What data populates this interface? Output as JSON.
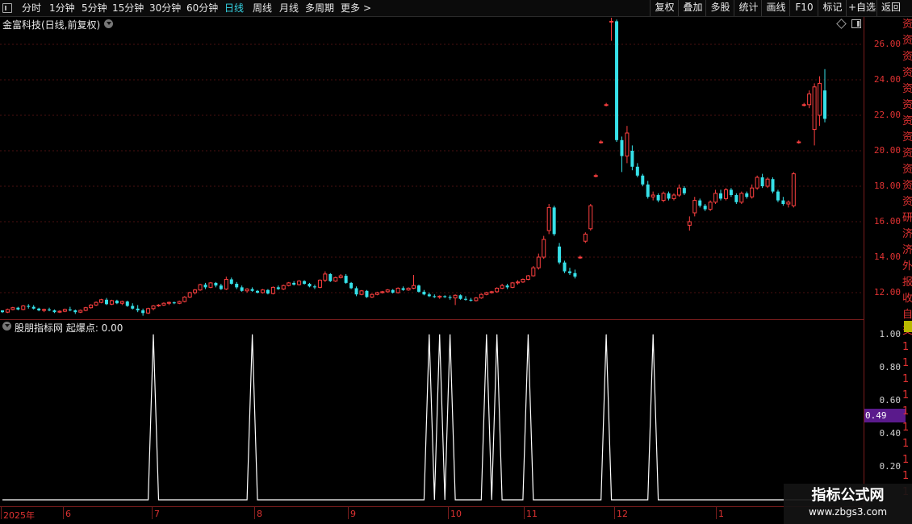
{
  "toolbar": {
    "periods": [
      {
        "label": "分时"
      },
      {
        "label": "1分钟"
      },
      {
        "label": "5分钟"
      },
      {
        "label": "15分钟"
      },
      {
        "label": "30分钟"
      },
      {
        "label": "60分钟"
      },
      {
        "label": "日线",
        "active": true
      },
      {
        "label": "周线"
      },
      {
        "label": "月线"
      },
      {
        "label": "多周期"
      },
      {
        "label": "更多"
      }
    ],
    "more_arrow": ">",
    "right_buttons": [
      {
        "label": "复权"
      },
      {
        "label": "叠加"
      },
      {
        "label": "多股"
      },
      {
        "label": "统计"
      },
      {
        "label": "画线"
      },
      {
        "label": "F10"
      },
      {
        "label": "标记"
      },
      {
        "label": "+自选"
      },
      {
        "label": "返回"
      }
    ]
  },
  "main_chart": {
    "title": "金富科技(日线,前复权)",
    "y_ticks": [
      "26.00",
      "24.00",
      "22.00",
      "20.00",
      "18.00",
      "16.00",
      "14.00",
      "12.00"
    ]
  },
  "indicator": {
    "title": "股朋指标网  起爆点: 0.00",
    "y_ticks": [
      "1.00",
      "0.80",
      "0.60",
      "0.40",
      "0.20"
    ],
    "current_value": "0.49"
  },
  "x_axis": {
    "labels": [
      "2025年",
      "6",
      "7",
      "8",
      "9",
      "10",
      "11",
      "12",
      "1"
    ]
  },
  "side_strip": {
    "chars": [
      "资",
      "资",
      "资",
      "资",
      "资",
      "资",
      "资",
      "资",
      "资",
      "资",
      "资",
      "资",
      "研",
      "济",
      "济",
      "外",
      "报",
      "收",
      "自",
      "交",
      "1",
      "1",
      "1",
      "1",
      "1",
      "1",
      "1",
      "1",
      "1",
      "1"
    ]
  },
  "watermark": {
    "title": "指标公式网",
    "url": "www.zbgs3.com"
  },
  "colors": {
    "up": "#ff4040",
    "down": "#36e0e8",
    "axis": "#e03232",
    "grid": "#4a1010",
    "signal": "#ffffff",
    "badge": "#5a1a8c"
  },
  "chart_data": [
    {
      "type": "candlestick",
      "title": "金富科技(日线,前复权)",
      "x_labels": [
        "2025年",
        "6",
        "7",
        "8",
        "9",
        "10",
        "11",
        "12",
        "1"
      ],
      "ylim": [
        10.5,
        27.5
      ],
      "y_ticks": [
        12,
        14,
        16,
        18,
        20,
        22,
        24,
        26
      ],
      "ohlc": [
        [
          11.0,
          11.0,
          10.85,
          10.9
        ],
        [
          10.9,
          11.1,
          10.85,
          11.05
        ],
        [
          11.05,
          11.2,
          11.0,
          11.15
        ],
        [
          11.15,
          11.2,
          11.0,
          11.05
        ],
        [
          11.05,
          11.3,
          11.0,
          11.25
        ],
        [
          11.25,
          11.35,
          11.1,
          11.2
        ],
        [
          11.2,
          11.3,
          11.05,
          11.1
        ],
        [
          11.1,
          11.15,
          10.95,
          11.0
        ],
        [
          11.0,
          11.1,
          10.9,
          11.05
        ],
        [
          11.05,
          11.15,
          10.95,
          11.0
        ],
        [
          11.0,
          11.05,
          10.85,
          10.9
        ],
        [
          10.9,
          11.0,
          10.85,
          10.95
        ],
        [
          10.95,
          11.1,
          10.9,
          11.05
        ],
        [
          11.05,
          11.2,
          10.95,
          11.0
        ],
        [
          11.0,
          11.05,
          10.8,
          10.9
        ],
        [
          10.9,
          11.05,
          10.85,
          11.0
        ],
        [
          11.0,
          11.2,
          10.95,
          11.15
        ],
        [
          11.15,
          11.35,
          11.1,
          11.3
        ],
        [
          11.3,
          11.5,
          11.25,
          11.45
        ],
        [
          11.45,
          11.65,
          11.4,
          11.6
        ],
        [
          11.6,
          11.7,
          11.3,
          11.35
        ],
        [
          11.35,
          11.6,
          11.3,
          11.55
        ],
        [
          11.55,
          11.6,
          11.35,
          11.4
        ],
        [
          11.4,
          11.55,
          11.3,
          11.5
        ],
        [
          11.5,
          11.55,
          11.2,
          11.25
        ],
        [
          11.25,
          11.4,
          11.05,
          11.1
        ],
        [
          11.1,
          11.3,
          10.9,
          11.0
        ],
        [
          11.0,
          11.1,
          10.7,
          10.85
        ],
        [
          10.85,
          11.15,
          10.8,
          11.1
        ],
        [
          11.1,
          11.3,
          11.0,
          11.25
        ],
        [
          11.25,
          11.35,
          11.2,
          11.3
        ],
        [
          11.3,
          11.45,
          11.25,
          11.4
        ],
        [
          11.4,
          11.5,
          11.3,
          11.45
        ],
        [
          11.45,
          11.5,
          11.35,
          11.4
        ],
        [
          11.4,
          11.55,
          11.35,
          11.5
        ],
        [
          11.5,
          11.8,
          11.45,
          11.75
        ],
        [
          11.75,
          12.05,
          11.7,
          12.0
        ],
        [
          12.0,
          12.2,
          11.9,
          12.15
        ],
        [
          12.15,
          12.5,
          12.1,
          12.45
        ],
        [
          12.45,
          12.55,
          12.2,
          12.3
        ],
        [
          12.3,
          12.6,
          12.25,
          12.55
        ],
        [
          12.55,
          12.6,
          12.3,
          12.4
        ],
        [
          12.4,
          12.5,
          12.15,
          12.2
        ],
        [
          12.2,
          12.9,
          12.15,
          12.75
        ],
        [
          12.75,
          12.85,
          12.45,
          12.5
        ],
        [
          12.5,
          12.6,
          12.2,
          12.3
        ],
        [
          12.3,
          12.4,
          12.05,
          12.1
        ],
        [
          12.1,
          12.25,
          12.0,
          12.2
        ],
        [
          12.2,
          12.3,
          12.05,
          12.1
        ],
        [
          12.1,
          12.15,
          11.95,
          12.0
        ],
        [
          12.0,
          12.2,
          11.95,
          12.15
        ],
        [
          12.15,
          12.2,
          11.9,
          11.95
        ],
        [
          11.95,
          12.35,
          11.9,
          12.3
        ],
        [
          12.3,
          12.4,
          12.15,
          12.2
        ],
        [
          12.2,
          12.45,
          12.15,
          12.4
        ],
        [
          12.4,
          12.6,
          12.35,
          12.55
        ],
        [
          12.55,
          12.65,
          12.4,
          12.45
        ],
        [
          12.45,
          12.7,
          12.4,
          12.65
        ],
        [
          12.65,
          12.7,
          12.45,
          12.5
        ],
        [
          12.5,
          12.55,
          12.3,
          12.35
        ],
        [
          12.35,
          12.45,
          12.2,
          12.3
        ],
        [
          12.3,
          12.75,
          12.25,
          12.7
        ],
        [
          12.7,
          13.2,
          12.6,
          13.05
        ],
        [
          13.05,
          13.1,
          12.6,
          12.65
        ],
        [
          12.65,
          12.9,
          12.6,
          12.85
        ],
        [
          12.85,
          13.05,
          12.8,
          12.95
        ],
        [
          12.95,
          13.05,
          12.5,
          12.55
        ],
        [
          12.55,
          12.6,
          12.2,
          12.25
        ],
        [
          12.25,
          12.35,
          11.8,
          11.9
        ],
        [
          11.9,
          12.15,
          11.85,
          12.1
        ],
        [
          12.1,
          12.15,
          11.7,
          11.75
        ],
        [
          11.75,
          11.95,
          11.7,
          11.9
        ],
        [
          11.9,
          12.05,
          11.85,
          12.0
        ],
        [
          12.0,
          12.1,
          11.95,
          12.05
        ],
        [
          12.05,
          12.2,
          12.0,
          12.15
        ],
        [
          12.15,
          12.2,
          11.95,
          12.0
        ],
        [
          12.0,
          12.3,
          11.95,
          12.25
        ],
        [
          12.25,
          12.35,
          12.1,
          12.15
        ],
        [
          12.15,
          12.3,
          12.1,
          12.25
        ],
        [
          12.25,
          13.0,
          12.2,
          12.4
        ],
        [
          12.4,
          12.45,
          12.0,
          12.05
        ],
        [
          12.05,
          12.15,
          11.85,
          11.9
        ],
        [
          11.9,
          12.0,
          11.75,
          11.8
        ],
        [
          11.8,
          11.9,
          11.7,
          11.75
        ],
        [
          11.75,
          11.85,
          11.65,
          11.8
        ],
        [
          11.8,
          11.85,
          11.7,
          11.75
        ],
        [
          11.75,
          11.85,
          11.6,
          11.7
        ],
        [
          11.7,
          11.9,
          11.3,
          11.85
        ],
        [
          11.85,
          11.9,
          11.6,
          11.65
        ],
        [
          11.65,
          11.8,
          11.55,
          11.6
        ],
        [
          11.6,
          11.7,
          11.5,
          11.55
        ],
        [
          11.55,
          11.75,
          11.5,
          11.7
        ],
        [
          11.7,
          11.95,
          11.65,
          11.9
        ],
        [
          11.9,
          12.05,
          11.85,
          12.0
        ],
        [
          12.0,
          12.1,
          11.95,
          12.05
        ],
        [
          12.05,
          12.3,
          12.0,
          12.25
        ],
        [
          12.25,
          12.5,
          12.2,
          12.4
        ],
        [
          12.4,
          12.5,
          12.2,
          12.3
        ],
        [
          12.3,
          12.6,
          12.25,
          12.55
        ],
        [
          12.55,
          12.7,
          12.45,
          12.6
        ],
        [
          12.6,
          12.8,
          12.55,
          12.75
        ],
        [
          12.75,
          13.0,
          12.7,
          12.95
        ],
        [
          12.95,
          13.5,
          12.9,
          13.4
        ],
        [
          13.4,
          14.2,
          13.3,
          14.0
        ],
        [
          14.0,
          15.2,
          13.9,
          15.0
        ],
        [
          15.5,
          17.0,
          15.3,
          16.8
        ],
        [
          16.8,
          16.9,
          15.2,
          15.3
        ],
        [
          14.6,
          14.8,
          13.6,
          13.7
        ],
        [
          13.7,
          13.8,
          13.1,
          13.2
        ],
        [
          13.2,
          13.4,
          13.0,
          13.1
        ],
        [
          13.1,
          13.3,
          12.8,
          12.9
        ],
        [
          14.0,
          14.1,
          13.9,
          14.0
        ],
        [
          14.9,
          15.4,
          14.8,
          15.3
        ],
        [
          15.6,
          17.0,
          15.5,
          16.9
        ],
        [
          18.6,
          18.7,
          18.5,
          18.6
        ],
        [
          20.5,
          20.6,
          20.4,
          20.5
        ],
        [
          22.6,
          22.7,
          22.5,
          22.6
        ],
        [
          27.3,
          27.5,
          26.2,
          27.3
        ],
        [
          27.3,
          27.4,
          20.5,
          20.6
        ],
        [
          20.6,
          20.8,
          18.8,
          19.7
        ],
        [
          19.7,
          21.4,
          19.3,
          21.0
        ],
        [
          20.0,
          20.3,
          18.9,
          19.1
        ],
        [
          19.1,
          19.3,
          18.5,
          18.6
        ],
        [
          18.6,
          18.7,
          18.0,
          18.1
        ],
        [
          18.1,
          18.3,
          17.3,
          17.4
        ],
        [
          17.4,
          17.7,
          17.2,
          17.5
        ],
        [
          17.5,
          17.6,
          17.1,
          17.2
        ],
        [
          17.2,
          17.7,
          17.1,
          17.6
        ],
        [
          17.6,
          17.7,
          17.2,
          17.3
        ],
        [
          17.3,
          17.6,
          17.2,
          17.5
        ],
        [
          17.5,
          18.1,
          17.4,
          17.9
        ],
        [
          17.9,
          18.0,
          17.5,
          17.6
        ],
        [
          15.8,
          16.3,
          15.5,
          16.0
        ],
        [
          16.5,
          17.4,
          16.3,
          17.2
        ],
        [
          17.2,
          17.3,
          16.8,
          16.9
        ],
        [
          16.9,
          17.0,
          16.6,
          16.7
        ],
        [
          16.7,
          17.2,
          16.6,
          17.1
        ],
        [
          17.1,
          17.8,
          17.0,
          17.6
        ],
        [
          17.6,
          17.8,
          17.2,
          17.3
        ],
        [
          17.3,
          17.9,
          17.2,
          17.8
        ],
        [
          17.8,
          17.9,
          17.4,
          17.5
        ],
        [
          17.5,
          17.6,
          17.0,
          17.1
        ],
        [
          17.1,
          17.7,
          17.0,
          17.6
        ],
        [
          17.6,
          17.7,
          17.3,
          17.4
        ],
        [
          17.4,
          18.1,
          17.3,
          17.9
        ],
        [
          17.9,
          18.6,
          17.8,
          18.5
        ],
        [
          18.5,
          18.7,
          17.9,
          18.0
        ],
        [
          18.0,
          18.5,
          17.9,
          18.4
        ],
        [
          18.4,
          18.5,
          17.6,
          17.7
        ],
        [
          17.7,
          17.8,
          17.1,
          17.2
        ],
        [
          17.2,
          17.4,
          16.9,
          17.0
        ],
        [
          17.0,
          17.2,
          16.8,
          17.1
        ],
        [
          16.9,
          18.8,
          16.8,
          18.7
        ],
        [
          20.5,
          20.6,
          20.4,
          20.5
        ],
        [
          22.6,
          22.7,
          22.5,
          22.6
        ],
        [
          22.6,
          23.4,
          22.4,
          23.2
        ],
        [
          21.2,
          23.8,
          20.3,
          23.6
        ],
        [
          22.0,
          24.2,
          21.4,
          23.8
        ],
        [
          23.4,
          24.6,
          21.6,
          21.8
        ]
      ]
    },
    {
      "type": "line",
      "title": "股朋指标网  起爆点: 0.00",
      "ylim": [
        0,
        1.05
      ],
      "y_ticks": [
        0.2,
        0.4,
        0.6,
        0.8,
        1.0
      ],
      "signal_indices": [
        29,
        48,
        82,
        84,
        86,
        93,
        95,
        101,
        116,
        125
      ],
      "signal_value": 1.0,
      "base_value": 0.0
    }
  ]
}
